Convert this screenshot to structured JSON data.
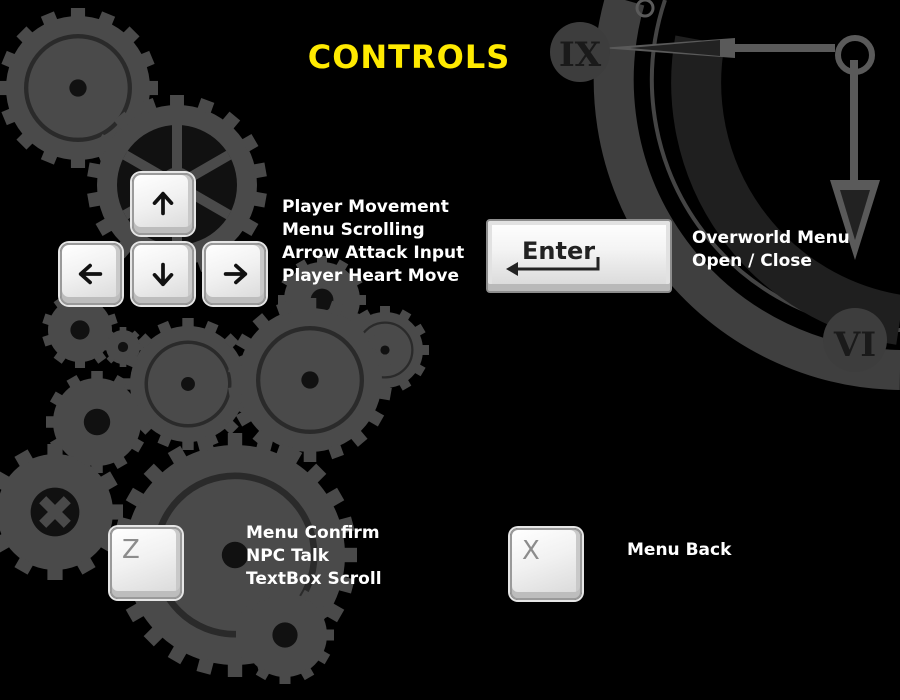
{
  "title": "CONTROLS",
  "colors": {
    "title": "#ffea00",
    "text": "#ffffff",
    "background": "#000000",
    "gear": "#4a4a4a"
  },
  "clock": {
    "numerals": [
      "IX",
      "VI"
    ]
  },
  "arrows": {
    "keys": [
      "arrow-up-icon",
      "arrow-left-icon",
      "arrow-down-icon",
      "arrow-right-icon"
    ],
    "lines": [
      "Player Movement",
      "Menu Scrolling",
      "Arrow Attack Input",
      "Player Heart Move"
    ]
  },
  "enter": {
    "label": "Enter",
    "lines": [
      "Overworld Menu",
      "Open / Close"
    ]
  },
  "z": {
    "label": "Z",
    "lines": [
      "Menu Confirm",
      "NPC Talk",
      "TextBox Scroll"
    ]
  },
  "x": {
    "label": "X",
    "lines": [
      "Menu Back"
    ]
  }
}
